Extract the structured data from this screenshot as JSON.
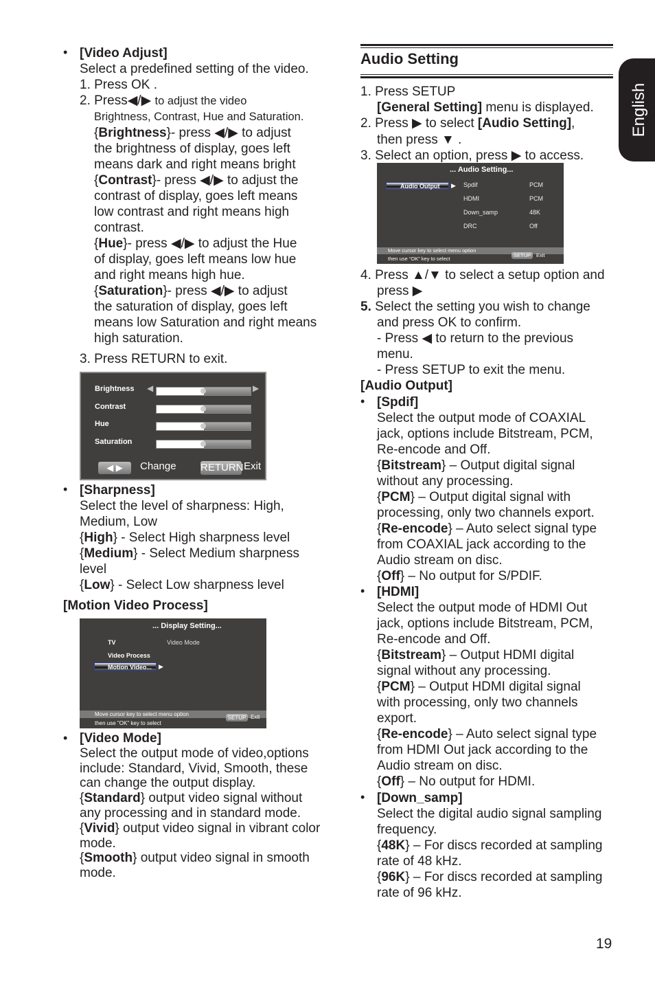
{
  "side_tab": "English",
  "page_number": "19",
  "left": {
    "bullet": "•",
    "video_adjust": [
      "**[Video Adjust]**",
      "Select a predefined setting of the video.",
      "1. Press OK ."
    ],
    "video_adjust_step2": "2. Press◀/▶ ",
    "video_adjust_step2_small": "to adjust the video",
    "video_adjust_desc": [
      "Brightness, Contrast, Hue and Saturation.",
      "{**Brightness**}- press ◀/▶ to adjust",
      "the brightness of display, goes left",
      "means dark and right means bright",
      "{**Contrast**}- press ◀/▶ to adjust the",
      "contrast of display, goes left means",
      "low contrast and right means high",
      "contrast.",
      "{**Hue**}- press ◀/▶ to adjust the Hue",
      "of display, goes left means low hue",
      "and right means high hue.",
      "{**Saturation**}- press ◀/▶ to adjust",
      "the saturation of display, goes left",
      "means low Saturation and right means",
      "high saturation."
    ],
    "video_adjust_step3": [
      "3. Press RETURN to exit."
    ],
    "sharpness": [
      "**[Sharpness]**",
      "Select the level of sharpness: High,",
      "Medium, Low",
      "{**High**} - Select High sharpness level",
      "{**Medium**} - Select Medium sharpness",
      "level",
      "{**Low**} - Select Low sharpness level"
    ],
    "motion_heading": [
      "**[Motion Video Process]**"
    ],
    "video_mode": [
      "**[Video Mode]**",
      "Select the output mode of video,options",
      "include: Standard, Vivid, Smooth, these",
      "can change the output display.",
      "{**Standard**} output video signal without",
      "any processing and in standard mode.",
      "{**Vivid**} output video signal in vibrant color",
      "mode.",
      "{**Smooth**} output video signal in smooth",
      "mode."
    ]
  },
  "picture_screen": {
    "items": [
      {
        "label": "Brightness",
        "value": 0.5
      },
      {
        "label": "Contrast",
        "value": 0.5
      },
      {
        "label": "Hue",
        "value": 0.5
      },
      {
        "label": "Saturation",
        "value": 0.5
      }
    ],
    "change_label": "Change",
    "return_button": "RETURN",
    "exit_label": "Exit"
  },
  "display_screen": {
    "title": "... Display Setting...",
    "menu": [
      "TV",
      "Video Process",
      "Motion Video..."
    ],
    "submenu": "Video Mode",
    "hint1": "Move cursor key to select menu option",
    "hint2": "then use \"OK\" key to select",
    "setup_button": "SETUP",
    "exit_label": "Exit"
  },
  "right": {
    "heading": "Audio Setting",
    "bullet": "•",
    "s1": [
      "1. Press SETUP"
    ],
    "s1b": [
      "**[General Setting]** menu is displayed."
    ],
    "s2": [
      "2. Press ▶ to select **[Audio Setting]**,"
    ],
    "s2b": [
      "then press ▼ ."
    ],
    "s3": [
      "3. Select an option, press ▶ to access."
    ],
    "s4": [
      "4. Press ▲/▼ to select a setup option and"
    ],
    "s4b": [
      "press ▶"
    ],
    "s5": [
      "**5.** Select the setting you wish to change"
    ],
    "s5b": [
      "and press OK to confirm.",
      "- Press ◀ to return to the previous",
      "menu.",
      "- Press SETUP to exit the menu."
    ],
    "audio_output": [
      "**[Audio Output]**"
    ],
    "spdif": [
      "**[Spdif]**",
      "Select the output mode of COAXIAL",
      "jack, options include Bitstream, PCM,",
      "Re-encode and Off.",
      "{**Bitstream**} – Output digital signal",
      "without any processing.",
      "{**PCM**} – Output digital signal with",
      "processing, only two channels export.",
      "{**Re-encode**} – Auto select signal type",
      "from COAXIAL jack according to the",
      "Audio stream on disc.",
      "{**Off**} – No output for S/PDIF."
    ],
    "hdmi": [
      "**[HDMI]**",
      "Select the output mode of HDMI Out",
      "jack, options include Bitstream, PCM,",
      "Re-encode and Off.",
      "{**Bitstream**} – Output HDMI digital",
      "signal without any processing.",
      "{**PCM**} – Output HDMI digital signal",
      "with processing, only two channels",
      "export.",
      "{**Re-encode**} – Auto select signal type",
      "from HDMI Out jack according to the",
      "Audio stream on disc.",
      "{**Off**} – No output for HDMI."
    ],
    "down_samp": [
      "**[Down_samp]**",
      "Select the digital audio signal sampling",
      "frequency.",
      "{**48K**} – For discs recorded at sampling",
      "rate of 48 kHz.",
      "{**96K**} – For discs recorded at sampling",
      "rate of 96 kHz."
    ]
  },
  "audio_screen": {
    "title": "... Audio Setting...",
    "menu": "Audio Output",
    "rows": [
      {
        "name": "Spdif",
        "value": "PCM"
      },
      {
        "name": "HDMI",
        "value": "PCM"
      },
      {
        "name": "Down_samp",
        "value": "48K"
      },
      {
        "name": "DRC",
        "value": "Off"
      }
    ],
    "hint1": "Move cursor key to select menu option",
    "hint2": "then use “OK” key to select",
    "setup_button": "SETUP",
    "exit_label": "Exit"
  }
}
